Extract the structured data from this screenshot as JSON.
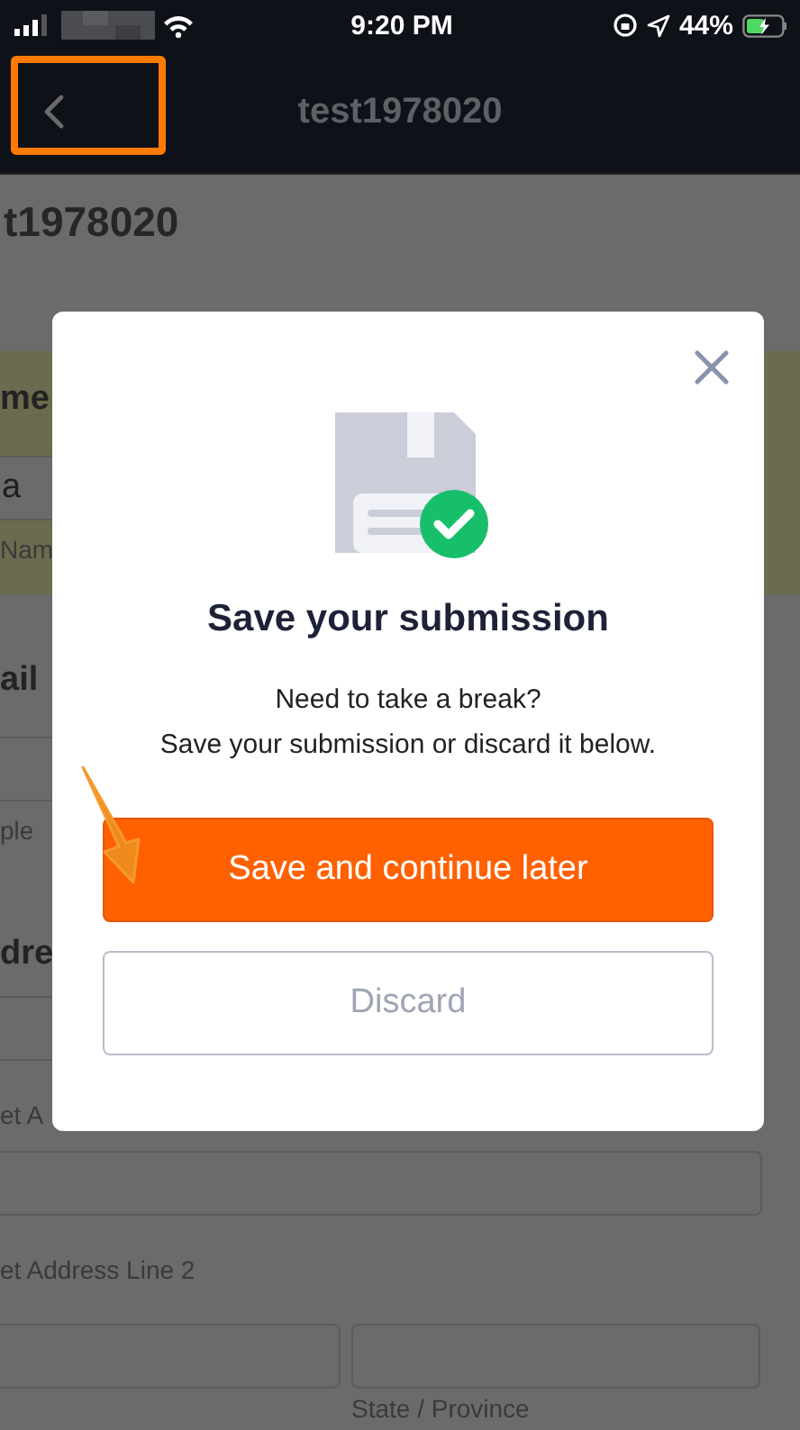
{
  "status_bar": {
    "time": "9:20 PM",
    "battery": "44%"
  },
  "nav_bar": {
    "title": "test1978020"
  },
  "form": {
    "heading": "t1978020",
    "sections": [
      {
        "highlighted": true,
        "items": [
          {
            "kind": "label",
            "text": "me"
          },
          {
            "kind": "field",
            "value": "a"
          },
          {
            "kind": "caption",
            "text": "Nam"
          }
        ]
      },
      {
        "highlighted": false,
        "items": [
          {
            "kind": "label",
            "text": "ail"
          },
          {
            "kind": "field"
          },
          {
            "kind": "caption",
            "text": "ple"
          }
        ]
      },
      {
        "highlighted": false,
        "items": [
          {
            "kind": "label",
            "text": "dre"
          },
          {
            "kind": "field"
          },
          {
            "kind": "caption",
            "text": "et A"
          },
          {
            "kind": "field"
          },
          {
            "kind": "caption",
            "text": "et Address Line 2"
          },
          {
            "kind": "field_pair"
          },
          {
            "kind": "caption_right",
            "text": "State / Province"
          }
        ]
      }
    ]
  },
  "modal": {
    "title": "Save your submission",
    "message": "Need to take a break?\nSave your submission or discard it below.",
    "buttons": [
      {
        "label": "Save and continue later",
        "kind": "primary"
      },
      {
        "label": "Discard",
        "kind": "secondary"
      }
    ]
  }
}
